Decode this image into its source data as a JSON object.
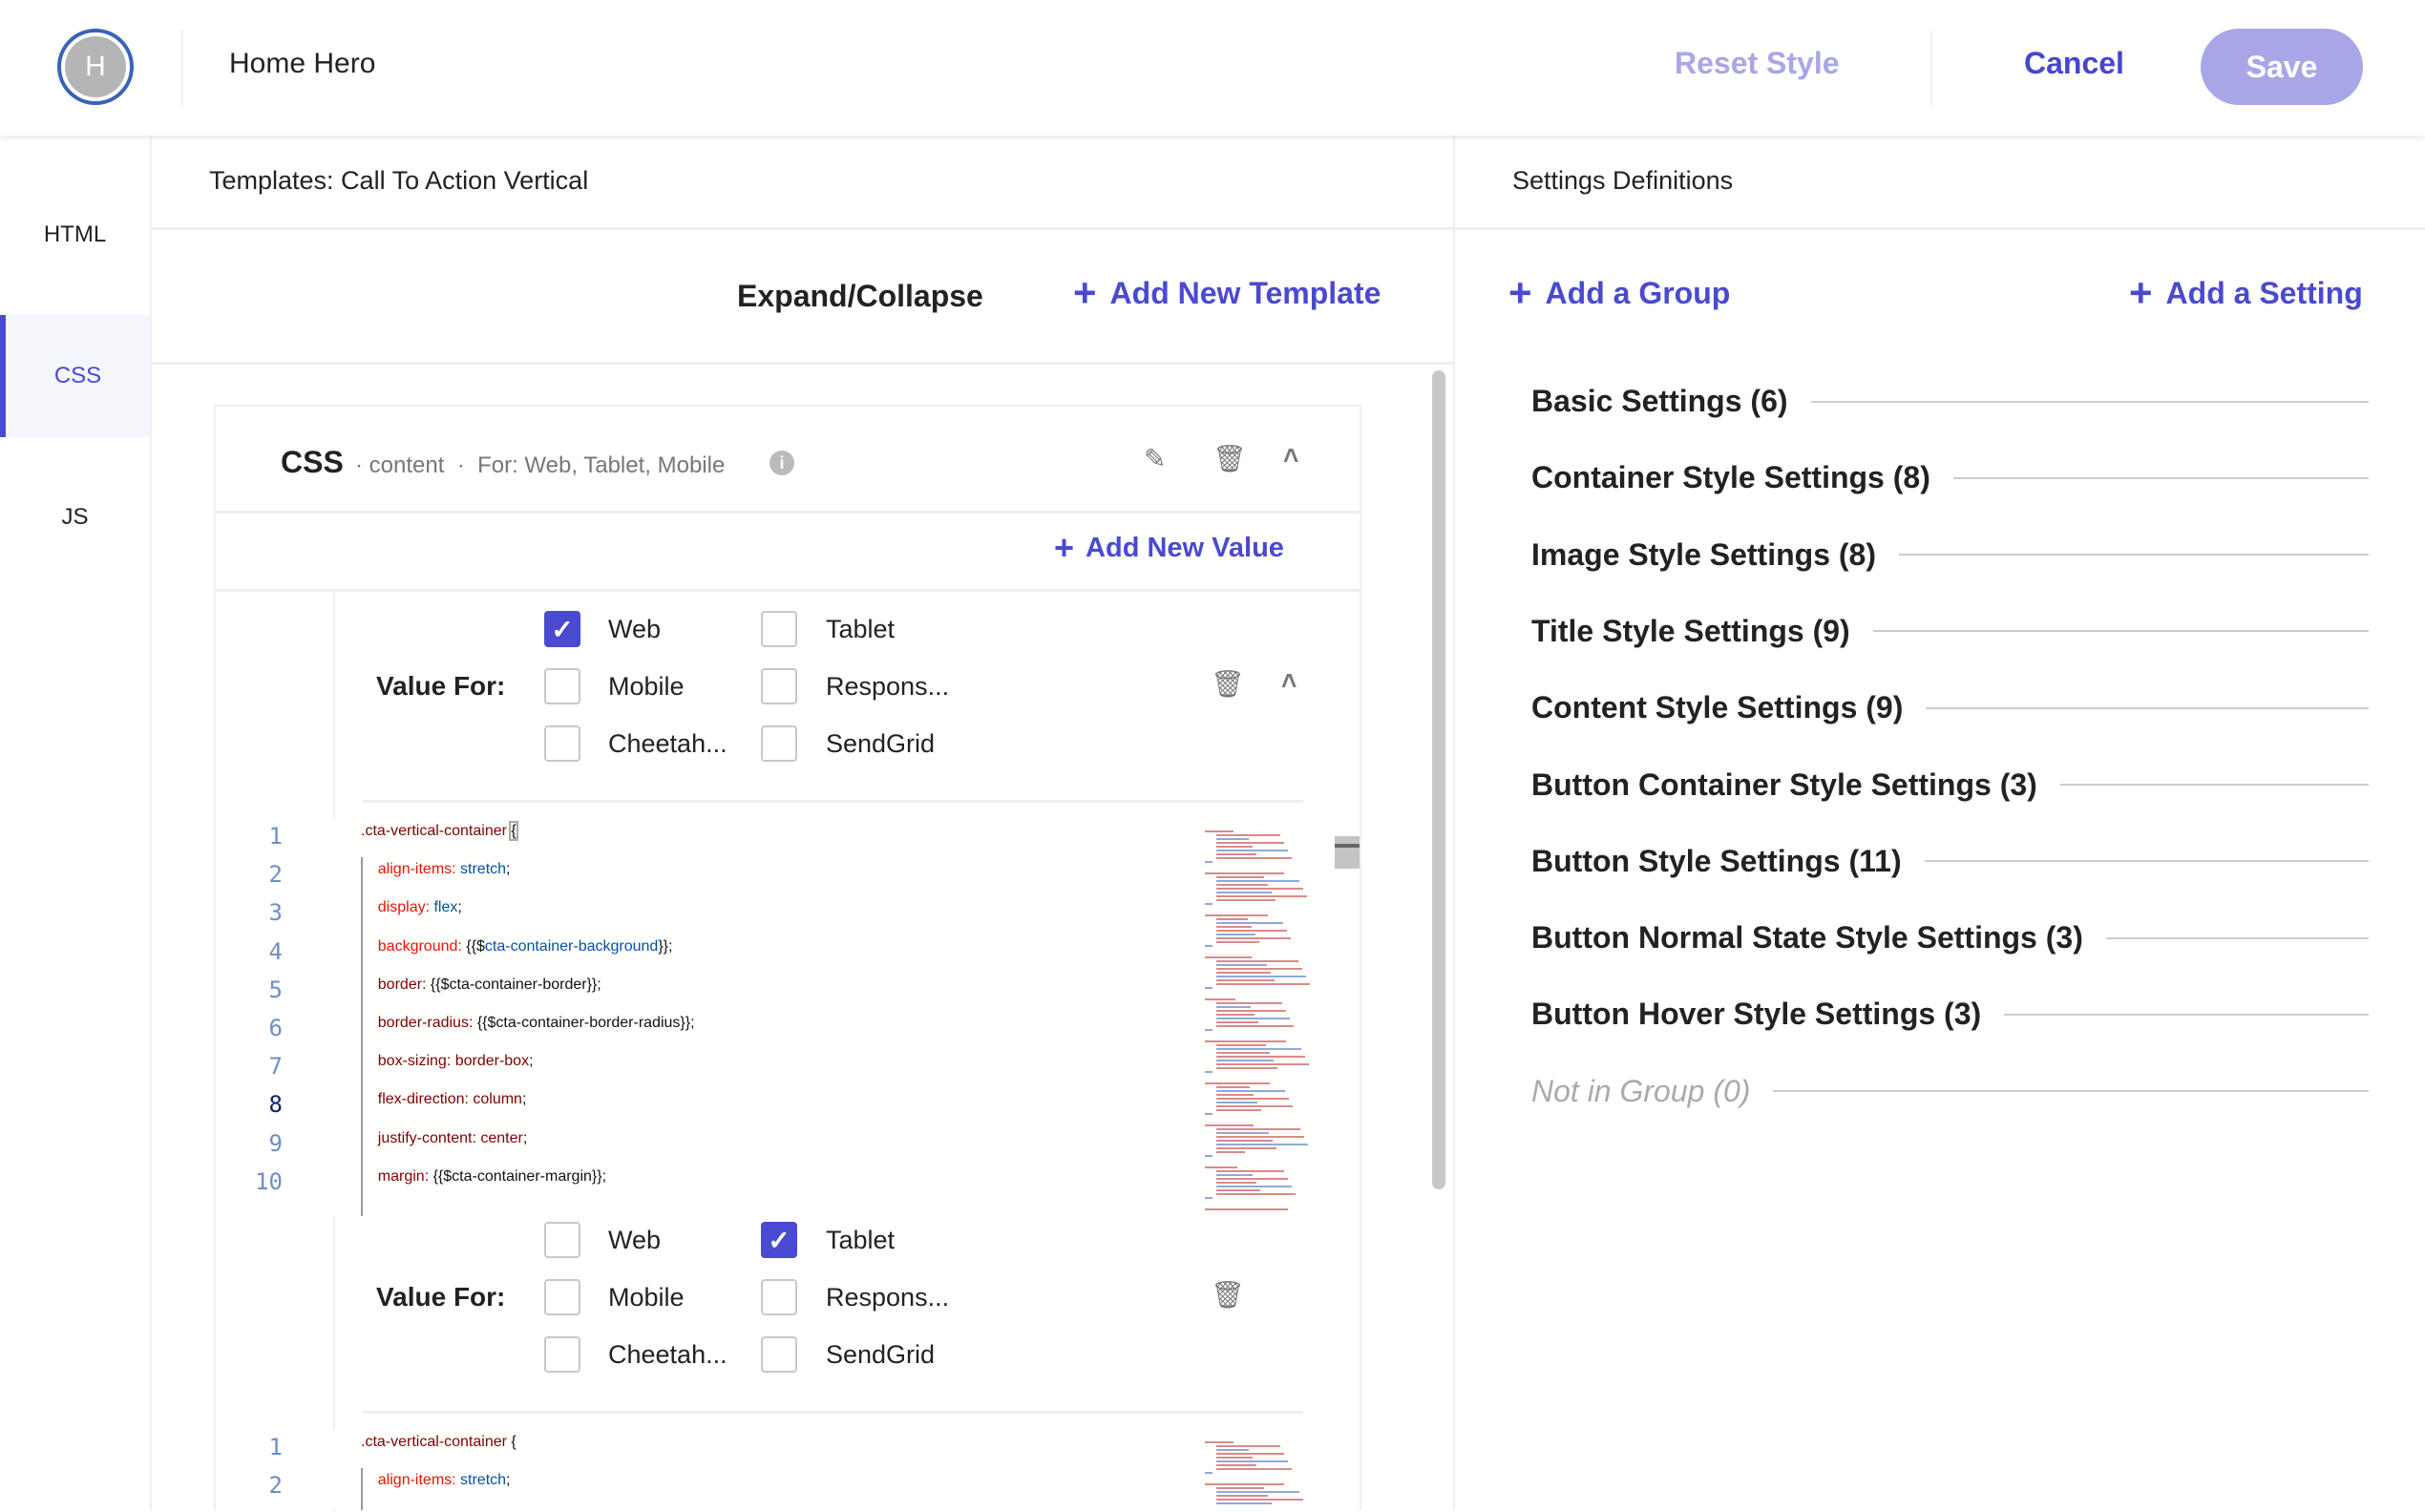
{
  "header": {
    "avatar_letter": "H",
    "title": "Home Hero",
    "reset_label": "Reset Style",
    "cancel_label": "Cancel",
    "save_label": "Save"
  },
  "sidebar": {
    "items": [
      {
        "label": "HTML",
        "active": false
      },
      {
        "label": "CSS",
        "active": true
      },
      {
        "label": "JS",
        "active": false
      }
    ]
  },
  "templates": {
    "title": "Templates: Call To Action Vertical",
    "expand_label": "Expand/Collapse",
    "add_template_label": "Add New Template"
  },
  "card": {
    "title": "CSS",
    "scope": "content",
    "for": "For: Web, Tablet, Mobile",
    "add_value_label": "Add New Value",
    "value_blocks": [
      {
        "label": "Value For:",
        "options": [
          {
            "label": "Web",
            "checked": true
          },
          {
            "label": "Tablet",
            "checked": false
          },
          {
            "label": "Mobile",
            "checked": false
          },
          {
            "label": "Respons...",
            "checked": false
          },
          {
            "label": "Cheetah...",
            "checked": false
          },
          {
            "label": "SendGrid",
            "checked": false
          }
        ],
        "code": [
          {
            "n": "1",
            "tokens": [
              [
                ".cta-vertical-container ",
                "sel"
              ],
              [
                "{",
                "pl brace"
              ]
            ]
          },
          {
            "n": "2",
            "tokens": [
              [
                "    align-items: ",
                "prop"
              ],
              [
                "stretch",
                "val"
              ],
              [
                ";",
                "pl"
              ]
            ]
          },
          {
            "n": "3",
            "tokens": [
              [
                "    display: ",
                "prop"
              ],
              [
                "flex",
                "val"
              ],
              [
                ";",
                "pl"
              ]
            ]
          },
          {
            "n": "4",
            "tokens": [
              [
                "    background: ",
                "prop"
              ],
              [
                "{{$",
                "pl"
              ],
              [
                "cta-container-background",
                "val"
              ],
              [
                "}};",
                "pl"
              ]
            ]
          },
          {
            "n": "5",
            "tokens": [
              [
                "    border: ",
                "dk"
              ],
              [
                "{{$cta-container-border}};",
                "pl"
              ]
            ]
          },
          {
            "n": "6",
            "tokens": [
              [
                "    border-radius: ",
                "dk"
              ],
              [
                "{{$cta-container-border-radius}};",
                "pl"
              ]
            ]
          },
          {
            "n": "7",
            "tokens": [
              [
                "    box-sizing: border-box",
                "dk"
              ],
              [
                ";",
                "pl"
              ]
            ]
          },
          {
            "n": "8",
            "tokens": [
              [
                "    flex-direction: column",
                "dk"
              ],
              [
                ";",
                "pl"
              ]
            ],
            "current": true
          },
          {
            "n": "9",
            "tokens": [
              [
                "    justify-content: center",
                "dk"
              ],
              [
                ";",
                "pl"
              ]
            ]
          },
          {
            "n": "10",
            "tokens": [
              [
                "    margin: ",
                "dk"
              ],
              [
                "{{$cta-container-margin}};",
                "pl"
              ]
            ]
          }
        ]
      },
      {
        "label": "Value For:",
        "options": [
          {
            "label": "Web",
            "checked": false
          },
          {
            "label": "Tablet",
            "checked": true
          },
          {
            "label": "Mobile",
            "checked": false
          },
          {
            "label": "Respons...",
            "checked": false
          },
          {
            "label": "Cheetah...",
            "checked": false
          },
          {
            "label": "SendGrid",
            "checked": false
          }
        ],
        "code": [
          {
            "n": "1",
            "tokens": [
              [
                ".cta-vertical-container ",
                "sel"
              ],
              [
                "{",
                "pl"
              ]
            ]
          },
          {
            "n": "2",
            "tokens": [
              [
                "    align-items: ",
                "prop"
              ],
              [
                "stretch",
                "val"
              ],
              [
                ";",
                "pl"
              ]
            ]
          }
        ]
      }
    ]
  },
  "settings": {
    "title": "Settings Definitions",
    "add_group_label": "Add a Group",
    "add_setting_label": "Add a Setting",
    "groups": [
      "Basic Settings (6)",
      "Container Style Settings (8)",
      "Image Style Settings (8)",
      "Title Style Settings (9)",
      "Content Style Settings (9)",
      "Button Container Style Settings (3)",
      "Button Style Settings (11)",
      "Button Normal State Style Settings (3)",
      "Button Hover Style Settings (3)",
      "Not in Group (0)"
    ]
  },
  "colors": {
    "accent": "#4a4ad0",
    "save_bg": "#a8a6e6",
    "avatar_ring": "#3a62b8"
  }
}
